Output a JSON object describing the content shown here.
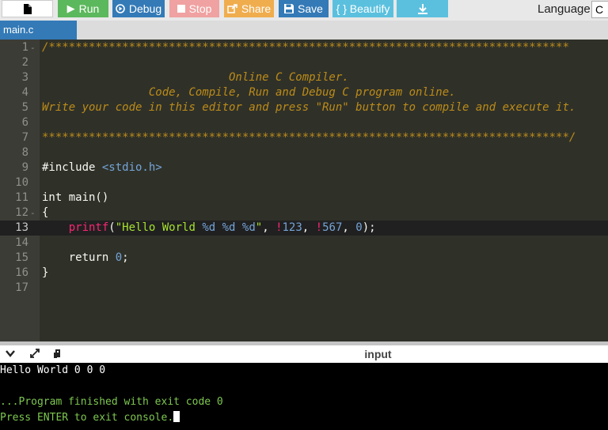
{
  "toolbar": {
    "new_icon": "file-icon",
    "run_label": "Run",
    "debug_label": "Debug",
    "stop_label": "Stop",
    "share_label": "Share",
    "save_label": "Save",
    "beautify_label": "{ } Beautify",
    "language_label": "Language",
    "language_value": "C"
  },
  "tab": {
    "label": "main.c"
  },
  "editor": {
    "active_line": 13,
    "lines": [
      {
        "n": "1",
        "fold": "-"
      },
      {
        "n": "2"
      },
      {
        "n": "3"
      },
      {
        "n": "4"
      },
      {
        "n": "5"
      },
      {
        "n": "6"
      },
      {
        "n": "7"
      },
      {
        "n": "8"
      },
      {
        "n": "9"
      },
      {
        "n": "10"
      },
      {
        "n": "11"
      },
      {
        "n": "12",
        "fold": "-"
      },
      {
        "n": "13"
      },
      {
        "n": "14"
      },
      {
        "n": "15"
      },
      {
        "n": "16"
      },
      {
        "n": "17"
      }
    ],
    "code": {
      "l1": "/******************************************************************************",
      "l3": "                            Online C Compiler.",
      "l4": "                Code, Compile, Run and Debug C program online.",
      "l5": "Write your code in this editor and press \"Run\" button to compile and execute it.",
      "l7": "*******************************************************************************/",
      "l9_pp": "#include ",
      "l9_hdr": "<stdio.h>",
      "l11": "int main()",
      "l12": "{",
      "l13_indent": "    ",
      "l13_fn": "printf",
      "l13_p1": "(",
      "l13_str1": "\"Hello World ",
      "l13_f1": "%d",
      "l13_s2": " ",
      "l13_f2": "%d",
      "l13_s3": " ",
      "l13_f3": "%d",
      "l13_str2": "\"",
      "l13_c1": ", ",
      "l13_op1": "!",
      "l13_n1": "123",
      "l13_c2": ", ",
      "l13_op2": "!",
      "l13_n2": "567",
      "l13_c3": ", ",
      "l13_n3": "0",
      "l13_end": ");",
      "l15_kw": "    return ",
      "l15_n": "0",
      "l15_end": ";",
      "l16": "}"
    }
  },
  "console": {
    "title": "input",
    "output": "Hello World 0 0 0",
    "finished": "...Program finished with exit code 0",
    "prompt": "Press ENTER to exit console."
  }
}
